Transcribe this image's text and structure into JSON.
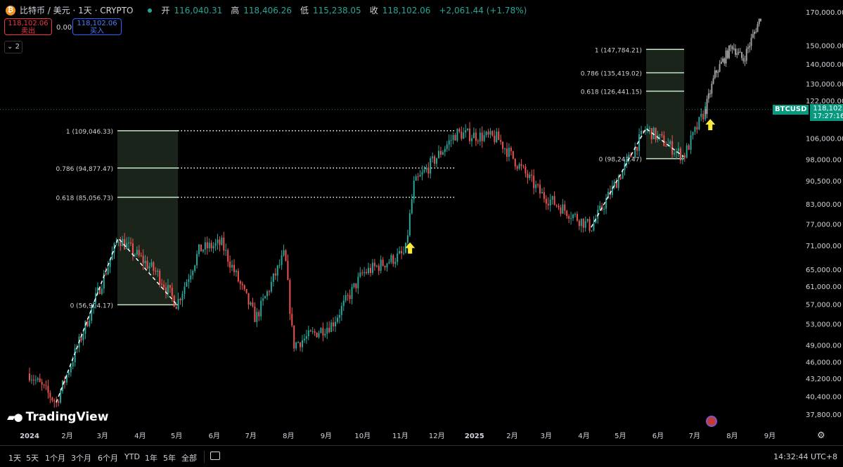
{
  "header": {
    "title": "比特币 / 美元 · 1天 · CRYPTO",
    "ohlc": [
      {
        "key": "开",
        "value": "116,040.31"
      },
      {
        "key": "高",
        "value": "118,406.26"
      },
      {
        "key": "低",
        "value": "115,238.05"
      },
      {
        "key": "收",
        "value": "118,102.06"
      }
    ],
    "change": "+2,061.44 (+1.78%)"
  },
  "trade": {
    "sell_price": "118,102.06",
    "sell_label": "卖出",
    "spread": "0.00",
    "buy_price": "118,102.06",
    "buy_label": "买入"
  },
  "indicators_toggle": "2",
  "logo_text": "TradingView",
  "price_tag": {
    "symbol": "BTCUSD",
    "price": "118,102.06",
    "countdown": "17:27:16"
  },
  "bottom_bar": {
    "ranges": [
      "1天",
      "5天",
      "1个月",
      "3个月",
      "6个月",
      "YTD",
      "1年",
      "5年",
      "全部"
    ],
    "time": "14:32:44 UTC+8"
  },
  "colors": {
    "up": "#26a69a",
    "down": "#ef5350",
    "projection": "#9e9e9e",
    "fib_line": "#c8e6c9",
    "box": "#1e2a1e",
    "arrow": "#ffeb3b"
  },
  "icons": [
    "bitcoin-icon",
    "calendar-icon",
    "settings-icon",
    "us-flag-icon",
    "chevron-down-icon"
  ],
  "chart_data": {
    "type": "candlestick",
    "symbol": "BTCUSD",
    "interval": "1D",
    "y_axis": {
      "scale": "log",
      "ticks": [
        37800,
        40400,
        43200,
        46000,
        49000,
        53000,
        57000,
        61000,
        65000,
        71000,
        77000,
        83000,
        90500,
        98000,
        106000,
        122000,
        130000,
        140000,
        150000,
        170000
      ],
      "tick_labels": [
        "37,800.00",
        "40,400.00",
        "43,200.00",
        "46,000.00",
        "49,000.00",
        "53,000.00",
        "57,000.00",
        "61,000.00",
        "65,000.00",
        "71,000.00",
        "77,000.00",
        "83,000.00",
        "90,500.00",
        "98,000.00",
        "106,000.00",
        "122,000.00",
        "130,000.00",
        "140,000.00",
        "150,000.00",
        "170,000.00"
      ]
    },
    "x_axis": {
      "tick_labels": [
        "2024",
        "2月",
        "3月",
        "4月",
        "5月",
        "6月",
        "7月",
        "8月",
        "9月",
        "10月",
        "11月",
        "12月",
        "2025",
        "2月",
        "3月",
        "4月",
        "5月",
        "6月",
        "7月",
        "8月",
        "9月"
      ]
    },
    "current_price": 118102.06,
    "price_path": [
      {
        "date": "2024-01-01",
        "price": 44000
      },
      {
        "date": "2024-01-23",
        "price": 39500
      },
      {
        "date": "2024-02-15",
        "price": 52000
      },
      {
        "date": "2024-03-14",
        "price": 73000
      },
      {
        "date": "2024-04-15",
        "price": 64000
      },
      {
        "date": "2024-05-01",
        "price": 57000
      },
      {
        "date": "2024-05-20",
        "price": 70000
      },
      {
        "date": "2024-06-07",
        "price": 71500
      },
      {
        "date": "2024-07-05",
        "price": 54000
      },
      {
        "date": "2024-07-29",
        "price": 69000
      },
      {
        "date": "2024-08-05",
        "price": 49000
      },
      {
        "date": "2024-09-06",
        "price": 53000
      },
      {
        "date": "2024-10-01",
        "price": 64000
      },
      {
        "date": "2024-11-05",
        "price": 69000
      },
      {
        "date": "2024-11-12",
        "price": 89000
      },
      {
        "date": "2024-12-17",
        "price": 108000
      },
      {
        "date": "2025-01-20",
        "price": 106000
      },
      {
        "date": "2025-02-25",
        "price": 86000
      },
      {
        "date": "2025-04-07",
        "price": 76000
      },
      {
        "date": "2025-05-22",
        "price": 110000
      },
      {
        "date": "2025-06-22",
        "price": 99000
      },
      {
        "date": "2025-07-10",
        "price": 118102
      }
    ],
    "projection_path": [
      {
        "date": "2025-07-10",
        "price": 118102
      },
      {
        "date": "2025-07-18",
        "price": 135000
      },
      {
        "date": "2025-08-01",
        "price": 150000
      },
      {
        "date": "2025-08-10",
        "price": 142000
      },
      {
        "date": "2025-08-25",
        "price": 168000
      }
    ],
    "fib_retracements": [
      {
        "levels": [
          {
            "ratio": "1",
            "price": "109,046.33"
          },
          {
            "ratio": "0.786",
            "price": "94,877.47"
          },
          {
            "ratio": "0.618",
            "price": "85,056.73"
          },
          {
            "ratio": "0",
            "price": "56,904.17"
          }
        ]
      },
      {
        "levels": [
          {
            "ratio": "1",
            "price": "147,784.21"
          },
          {
            "ratio": "0.786",
            "price": "135,419.02"
          },
          {
            "ratio": "0.618",
            "price": "126,441.15"
          },
          {
            "ratio": "0",
            "price": "98,242.47"
          }
        ]
      }
    ]
  }
}
